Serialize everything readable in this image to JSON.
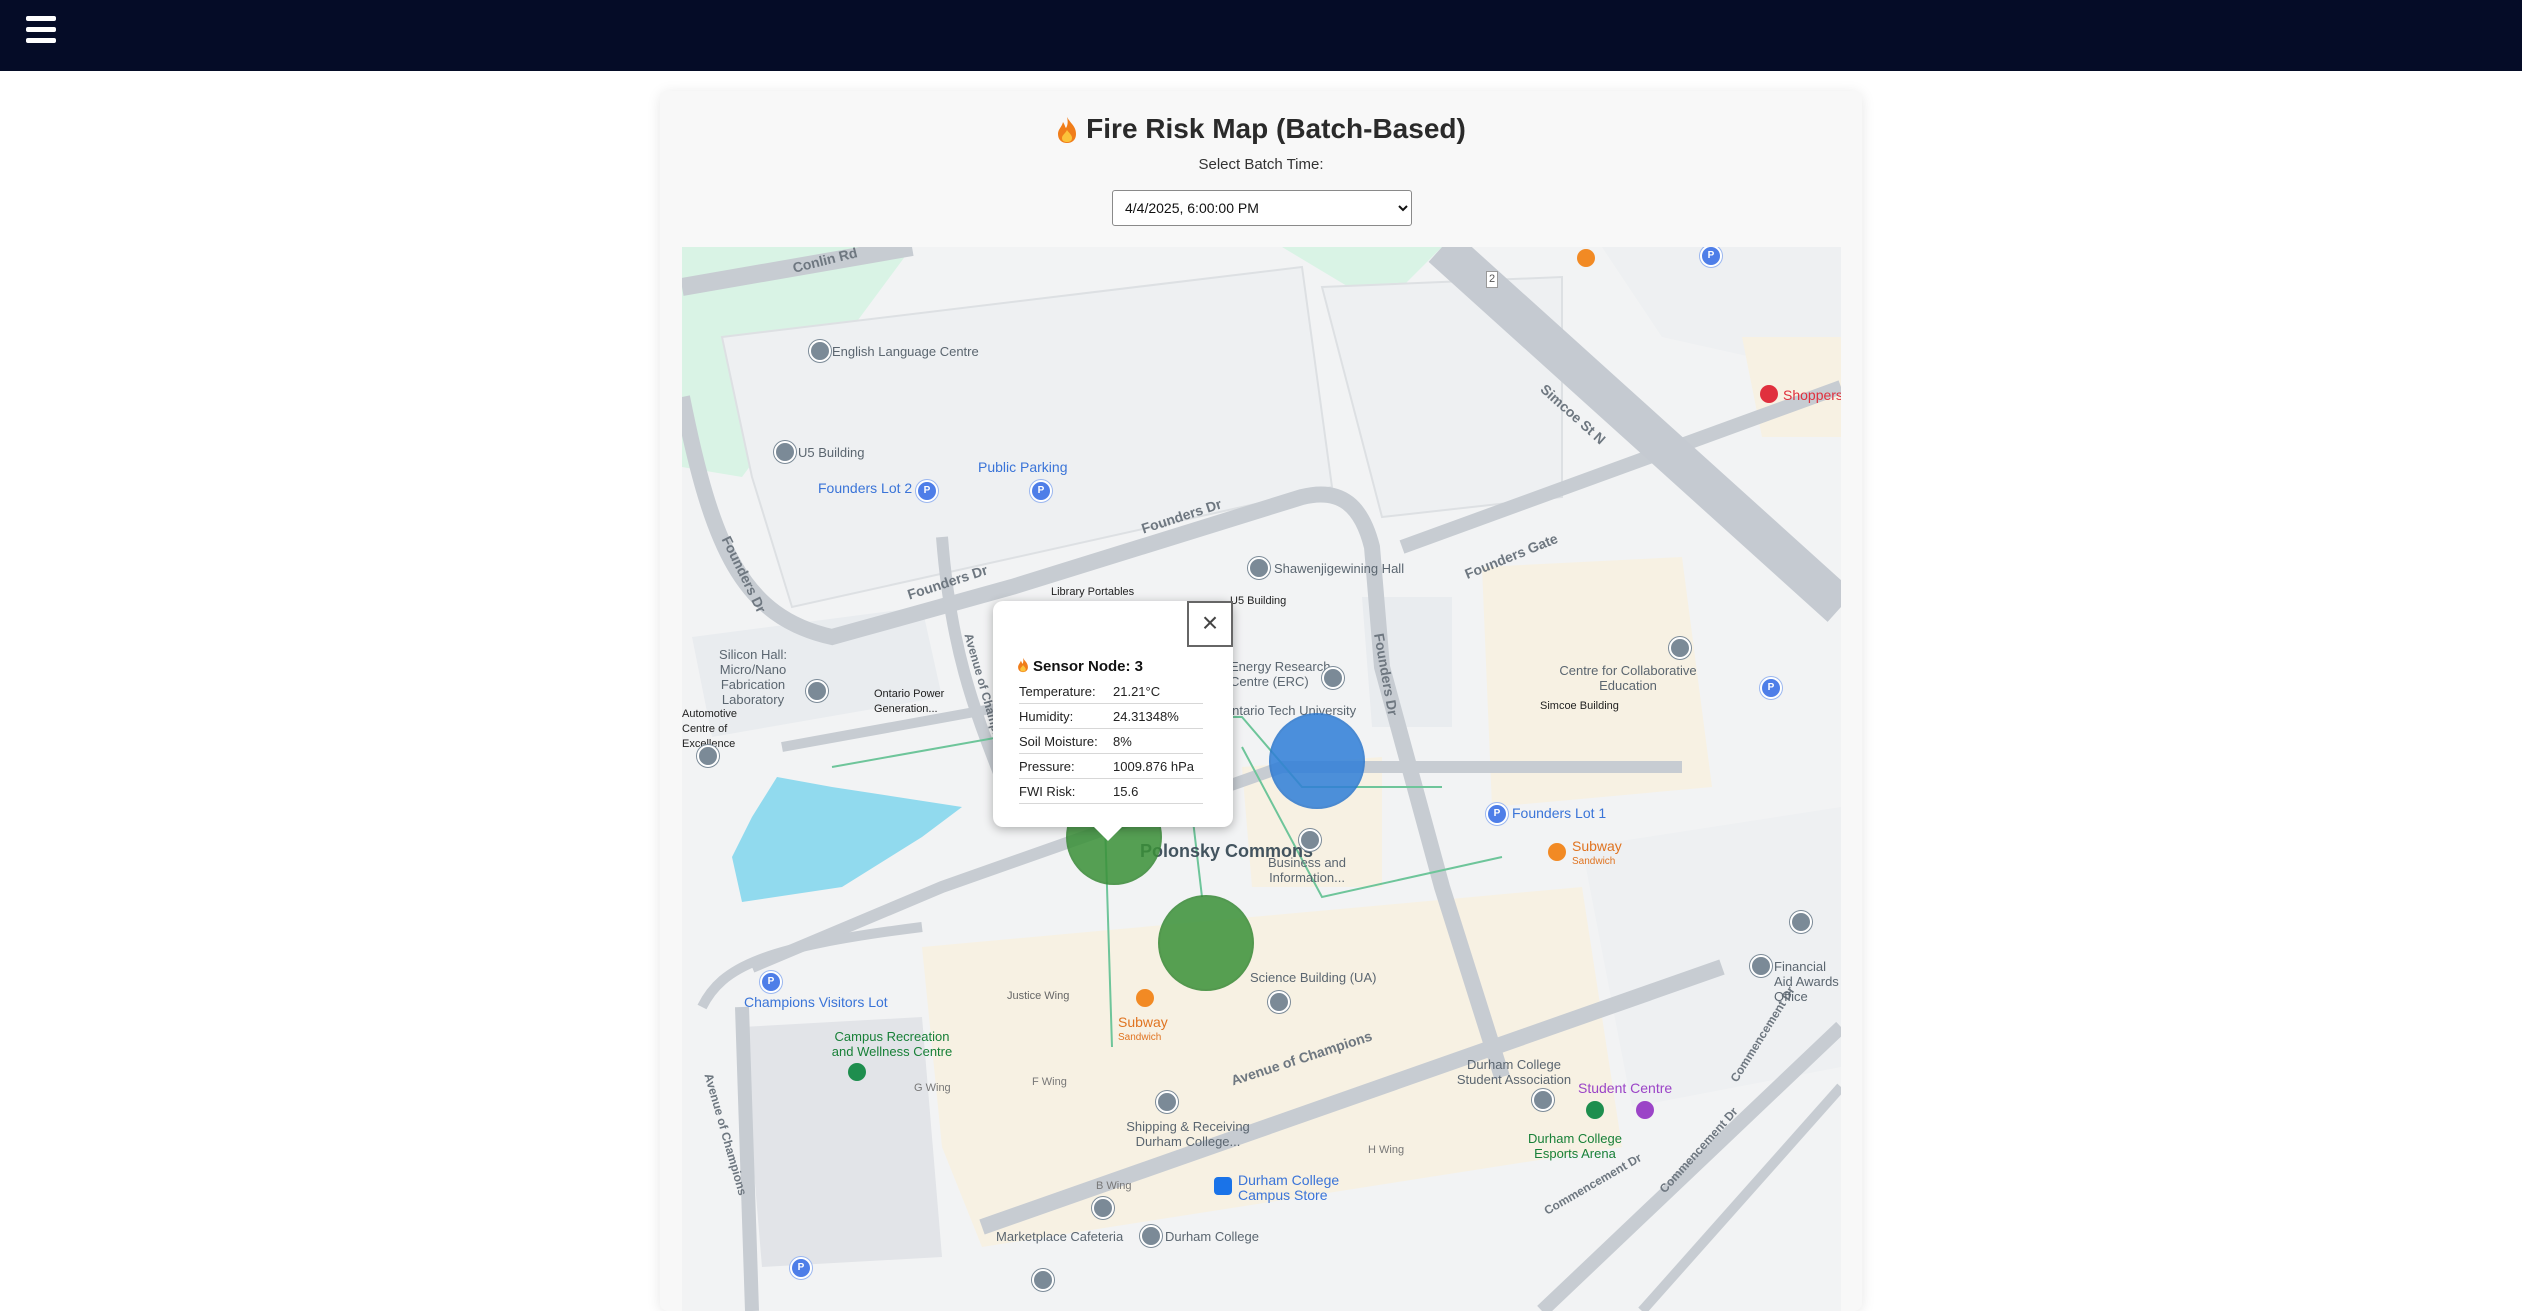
{
  "header": {
    "menu_icon": "hamburger-menu-icon",
    "background": "#050c27"
  },
  "page": {
    "title": "Fire Risk Map (Batch-Based)",
    "title_icon": "fire-icon",
    "batch_label": "Select Batch Time:",
    "batch_selected": "4/4/2025, 6:00:00 PM"
  },
  "map": {
    "labels": {
      "conlin_rd": "Conlin Rd",
      "english_language_centre": "English Language Centre",
      "u5_building": "U5 Building",
      "founders_lot_2": "Founders Lot 2",
      "public_parking": "Public Parking",
      "founders_dr_1": "Founders Dr",
      "founders_dr_2": "Founders Dr",
      "founders_dr_3": "Founders Dr",
      "shawenjigewining_hall": "Shawenjigewining Hall",
      "founders_gate": "Founders Gate",
      "library_portables": "Library Portables",
      "u5_building_2": "U5 Building",
      "simcoe_st_n": "Simcoe St N",
      "shoppers": "Shoppers",
      "silicon_hall": "Silicon Hall: Micro/Nano Fabrication Laboratory",
      "ontario_power_generation": "Ontario Power Generation...",
      "automotive_centre": "Automotive Centre of Excellence",
      "energy_research_centre": "Energy Research Centre (ERC)",
      "ontario_tech_university": "Ontario Tech University",
      "centre_collaborative_education": "Centre for Collaborative Education",
      "simcoe_building": "Simcoe Building",
      "founders_lot_1": "Founders Lot 1",
      "subway_1": "Subway",
      "subway_1_sub": "Sandwich",
      "polonsky_commons": "Polonsky Commons",
      "business_information": "Business and Information...",
      "science_building": "Science Building (UA)",
      "champions_visitors_lot": "Champions Visitors Lot",
      "justice_wing": "Justice Wing",
      "subway_2": "Subway",
      "subway_2_sub": "Sandwich",
      "campus_recreation": "Campus Recreation and Wellness Centre",
      "avenue_of_champions": "Avenue of Champions",
      "avenue_of_champions_2": "Avenue of Champions",
      "avenue_of_champions_3": "Avenue of Champions",
      "g_wing": "G Wing",
      "f_wing": "F Wing",
      "shipping_receiving": "Shipping & Receiving Durham College...",
      "durham_college_student_association": "Durham College Student Association",
      "student_centre": "Student Centre",
      "durham_college_esports": "Durham College Esports Arena",
      "h_wing": "H Wing",
      "b_wing": "B Wing",
      "durham_college_campus_store": "Durham College Campus Store",
      "marketplace_cafeteria": "Marketplace Cafeteria",
      "durham_college": "Durham College",
      "commencement_dr_1": "Commencement Dr",
      "commencement_dr_2": "Commencement Dr",
      "commencement_dr_3": "Commencement Dr",
      "financial_aid": "Financial Aid Awards Office",
      "founders_dr_vertical": "Founders Dr",
      "founders_dr_left": "Founders Dr",
      "route_number": "2"
    },
    "sensors": [
      {
        "name": "Sensor Node 3",
        "color": "#3a86d6"
      },
      {
        "name": "green-sensor-a",
        "color": "#3f9a3a"
      },
      {
        "name": "green-sensor-b",
        "color": "#3f9a3a"
      }
    ]
  },
  "popup": {
    "title": "Sensor Node: 3",
    "rows": [
      {
        "label": "Temperature:",
        "value": "21.21°C"
      },
      {
        "label": "Humidity:",
        "value": "24.31348%"
      },
      {
        "label": "Soil Moisture:",
        "value": "8%"
      },
      {
        "label": "Pressure:",
        "value": "1009.876 hPa"
      },
      {
        "label": "FWI Risk:",
        "value": "15.6"
      }
    ],
    "close_label": "×"
  }
}
